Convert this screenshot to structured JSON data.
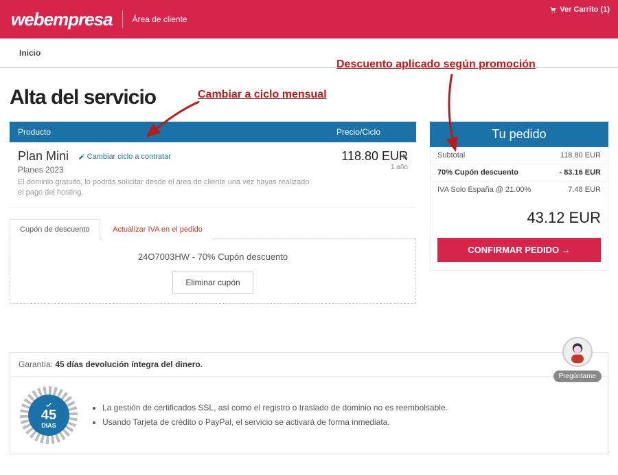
{
  "header": {
    "logo": "webempresa",
    "area": "Área de cliente",
    "cart": "Ver Carrito (1)"
  },
  "nav": {
    "home": "Inicio"
  },
  "page_title": "Alta del servicio",
  "annotations": {
    "cycle": "Cambiar a ciclo mensual",
    "discount": "Descuento aplicado según promoción"
  },
  "product_table": {
    "col_product": "Producto",
    "col_price": "Precio/Ciclo",
    "item": {
      "name": "Plan Mini",
      "change_cycle": "Cambiar ciclo a contratar",
      "sub": "Planes 2023",
      "note": "El dominio gratuito, lo podrás solicitar desde el área de cliente una vez hayas realizado el pago del hosting.",
      "price": "118.80 EUR",
      "term": "1 año",
      "remove": "×"
    }
  },
  "tabs": {
    "coupon": "Cupón de descuento",
    "iva": "Actualizar IVA en el pedido"
  },
  "coupon": {
    "text": "24O7003HW - 70% Cupón descuento",
    "remove": "Eliminar cupón"
  },
  "order": {
    "title": "Tu pedido",
    "subtotal_label": "Subtotal",
    "subtotal": "118.80 EUR",
    "discount_label": "70% Cupón descuento",
    "discount": "- 83.16 EUR",
    "tax_label": "IVA Solo España @ 21.00%",
    "tax": "7.48 EUR",
    "total": "43.12 EUR",
    "confirm": "CONFIRMAR PEDIDO"
  },
  "guarantee": {
    "prefix": "Garantía: ",
    "title": "45 días devolución íntegra del dinero.",
    "badge_days": "45",
    "badge_label": "DIAS",
    "bullets": [
      "La gestión de certificados SSL, así como el registro o traslado de dominio no es reembolsable.",
      "Usando Tarjeta de crédito o PayPal, el servicio se activará de forma inmediata."
    ]
  },
  "chat": {
    "label": "Pregúntame"
  }
}
